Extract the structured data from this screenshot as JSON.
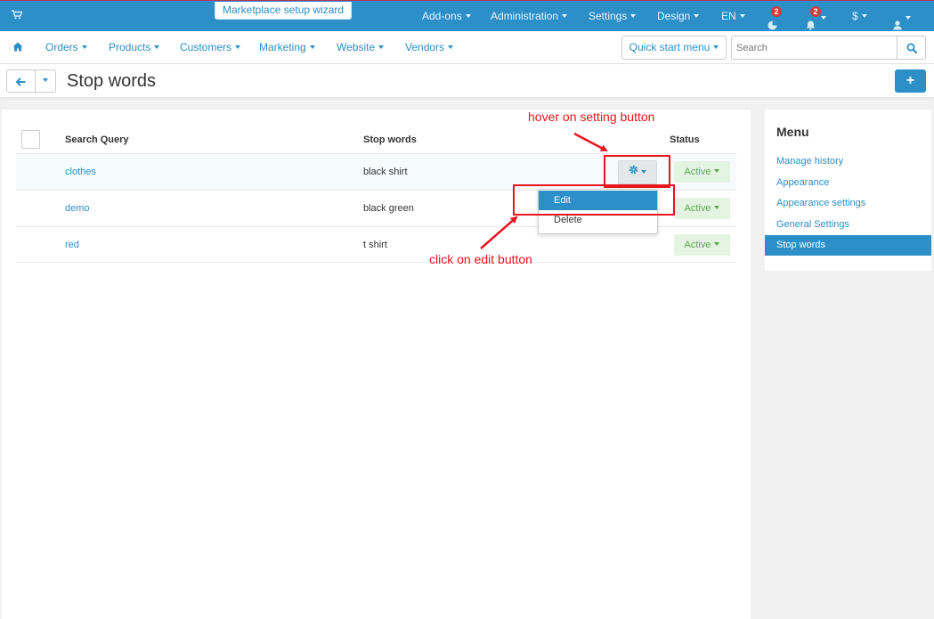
{
  "topbar": {
    "cart_icon": "shopping-cart-icon",
    "wizard_label": "Marketplace setup wizard",
    "nav": [
      {
        "label": "Add-ons"
      },
      {
        "label": "Administration"
      },
      {
        "label": "Settings"
      },
      {
        "label": "Design"
      },
      {
        "label": "EN"
      }
    ],
    "notifications_badge": "2",
    "bell_badge": "2",
    "currency_label": "$",
    "user_icon": "user-icon",
    "accent_color": "#2c8fc8"
  },
  "secondbar": {
    "home_icon": "home-icon",
    "menu": [
      {
        "label": "Orders"
      },
      {
        "label": "Products"
      },
      {
        "label": "Customers"
      },
      {
        "label": "Marketing"
      },
      {
        "label": "Website"
      },
      {
        "label": "Vendors"
      }
    ],
    "quick_start_label": "Quick start menu",
    "search_placeholder": "Search"
  },
  "titlebar": {
    "back_icon": "arrow-left-icon",
    "title": "Stop words",
    "add_label": "+"
  },
  "table": {
    "headers": {
      "query": "Search Query",
      "words": "Stop words",
      "status": "Status"
    },
    "rows": [
      {
        "query": "clothes",
        "words": "black shirt",
        "status": "Active"
      },
      {
        "query": "demo",
        "words": "black green",
        "status": "Active"
      },
      {
        "query": "red",
        "words": "t shirt",
        "status": "Active"
      }
    ],
    "status_color": "#5aa84f"
  },
  "dropdown": {
    "items": [
      {
        "label": "Edit"
      },
      {
        "label": "Delete"
      }
    ]
  },
  "sidebar": {
    "title": "Menu",
    "items": [
      {
        "label": "Manage history"
      },
      {
        "label": "Appearance"
      },
      {
        "label": "Appearance settings"
      },
      {
        "label": "General Settings"
      },
      {
        "label": "Stop words"
      }
    ]
  },
  "annotations": {
    "hover_text": "hover on setting button",
    "click_text": "click on edit button",
    "color": "#e8141e"
  }
}
